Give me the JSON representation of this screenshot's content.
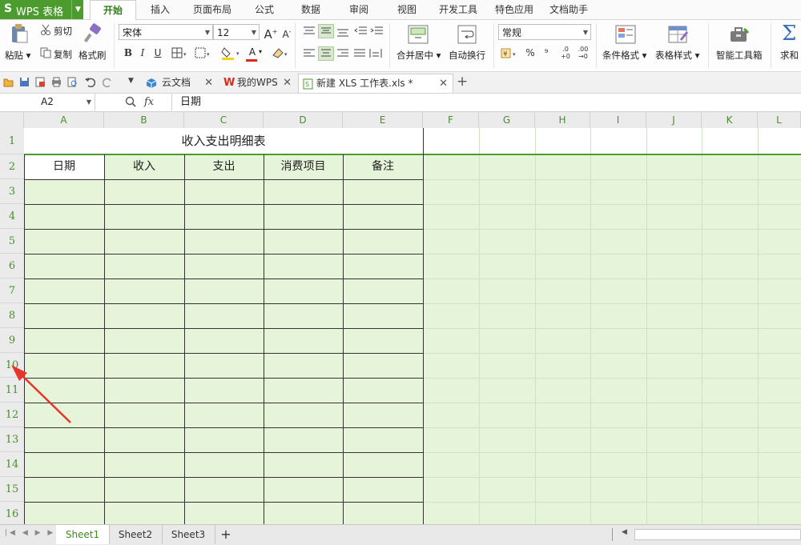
{
  "app": {
    "logo": "S",
    "name": "WPS 表格"
  },
  "menu_tabs": [
    "开始",
    "插入",
    "页面布局",
    "公式",
    "数据",
    "审阅",
    "视图",
    "开发工具",
    "特色应用",
    "文档助手"
  ],
  "ribbon": {
    "paste": "粘贴",
    "cut": "剪切",
    "copy": "复制",
    "format_painter": "格式刷",
    "font_name": "宋体",
    "font_size": "12",
    "merge_center": "合并居中",
    "wrap_text": "自动换行",
    "number_format": "常规",
    "conditional_format": "条件格式",
    "table_style": "表格样式",
    "smart_toolbox": "智能工具箱",
    "sum": "求和",
    "bold": "B",
    "italic": "I",
    "underline": "U",
    "increase_font": "A",
    "decrease_font": "A",
    "font_color": "A",
    "percent": "%",
    "comma": "⁹",
    "dec_inc": ".00",
    "dec_dec": ".0"
  },
  "doc_tabs": [
    {
      "label": "云文档",
      "icon": "cloud-icon"
    },
    {
      "label": "我的WPS",
      "icon": "wps-logo-icon"
    },
    {
      "label": "新建 XLS 工作表.xls *",
      "icon": "spreadsheet-file-icon"
    }
  ],
  "formula_bar": {
    "name_box": "A2",
    "fx": "fx",
    "value": "日期"
  },
  "columns": [
    "A",
    "B",
    "C",
    "D",
    "E",
    "F",
    "G",
    "H",
    "I",
    "J",
    "K",
    "L"
  ],
  "rows": [
    "1",
    "2",
    "3",
    "4",
    "5",
    "6",
    "7",
    "8",
    "9",
    "10",
    "11",
    "12",
    "13",
    "14",
    "15",
    "16"
  ],
  "table": {
    "title": "收入支出明细表",
    "headers": [
      "日期",
      "收入",
      "支出",
      "消费项目",
      "备注"
    ]
  },
  "sheets": [
    "Sheet1",
    "Sheet2",
    "Sheet3"
  ],
  "add_sheet": "+",
  "colors": {
    "accent": "#4c9b2f",
    "grid_bg": "#e6f5d9",
    "header_text": "#4a8d2b",
    "arrow": "#e8352b"
  }
}
